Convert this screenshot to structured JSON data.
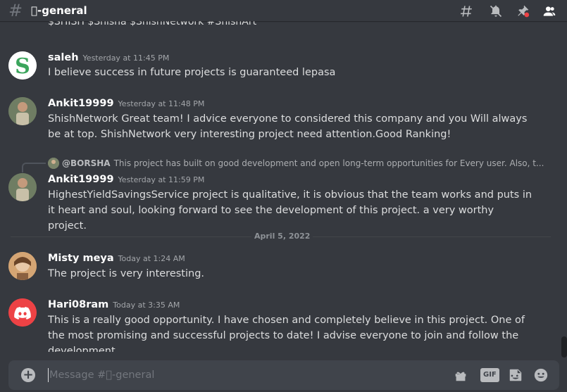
{
  "header": {
    "hash": "#",
    "channel_name": "\u0000-general",
    "icons": [
      "threads-icon",
      "mute-bell-icon",
      "pin-icon",
      "members-icon"
    ]
  },
  "messages": {
    "cut_text": "$SHISH $Shisha $ShishNetwork #ShishArt",
    "items": [
      {
        "author": "saleh",
        "timestamp": "Yesterday at 11:45 PM",
        "text": "I believe success in future projects is guaranteed lepasa"
      },
      {
        "author": "Ankit19999",
        "timestamp": "Yesterday at 11:48 PM",
        "text": "ShishNetwork Great team! I advice everyone to considered this company and you Will always be at top. ShishNetwork very interesting project need attention.Good Ranking!"
      },
      {
        "reply_author": "@BORSHA",
        "reply_text": "This project has built on good development and open long-term opportunities for Every user. Also, t...",
        "author": "Ankit19999",
        "timestamp": "Yesterday at 11:59 PM",
        "text": "HighestYieldSavingsService project is qualitative, it is obvious that the team works and puts in it heart and soul, looking forward to see the development of this project. a very worthy project."
      },
      {
        "author": "Misty meya",
        "timestamp": "Today at 1:24 AM",
        "text": "The project is very interesting."
      },
      {
        "author": "Hari08ram",
        "timestamp": "Today at 3:35 AM",
        "text": "This is a really good opportunity. I have chosen and completely believe in this project. One of the most promising and successful projects to date! I advise everyone to join and follow the development."
      }
    ],
    "date_divider": "April 5, 2022"
  },
  "composer": {
    "plus": "+",
    "placeholder": "Message #\u0000-general",
    "gif_label": "GIF",
    "icons": [
      "gift-icon",
      "gif-icon",
      "sticker-icon",
      "emoji-icon"
    ]
  },
  "colors": {
    "background": "#36393f",
    "input_bg": "#40444b",
    "text": "#dcddde",
    "muted": "#a3a6aa",
    "white": "#ffffff",
    "mute_badge": "#ed4245",
    "discord_red": "#ed4245",
    "saleh_green": "#3ba55c"
  }
}
